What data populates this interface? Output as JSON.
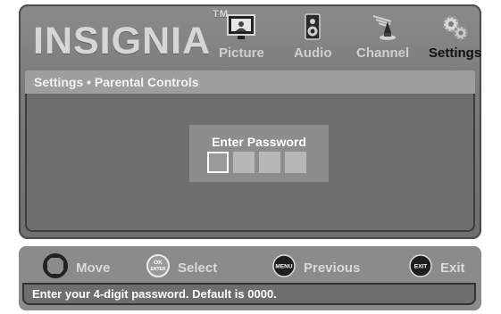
{
  "brand": {
    "logo_text": "INSIGNIA",
    "trademark": "TM"
  },
  "menu": {
    "tabs": [
      {
        "label": "Picture",
        "icon": "picture-icon",
        "active": false
      },
      {
        "label": "Audio",
        "icon": "speaker-icon",
        "active": false
      },
      {
        "label": "Channel",
        "icon": "antenna-icon",
        "active": false
      },
      {
        "label": "Settings",
        "icon": "gears-icon",
        "active": true
      }
    ]
  },
  "breadcrumb": "Settings • Parental Controls",
  "password": {
    "label": "Enter Password",
    "digits": [
      "",
      "",
      "",
      ""
    ],
    "active_index": 0
  },
  "hints": {
    "move": "Move",
    "select": "Select",
    "select_button": "OK ENTER",
    "previous": "Previous",
    "previous_button": "MENU",
    "exit": "Exit",
    "exit_button": "EXIT"
  },
  "status": "Enter your 4-digit password. Default is 0000.",
  "colors": {
    "window_bg": "#7a7a7a",
    "panel_bg": "#6e6e6e",
    "bar_bg": "#8b8b8b",
    "active_text": "#111111",
    "inactive_text": "#cfcfcf"
  }
}
